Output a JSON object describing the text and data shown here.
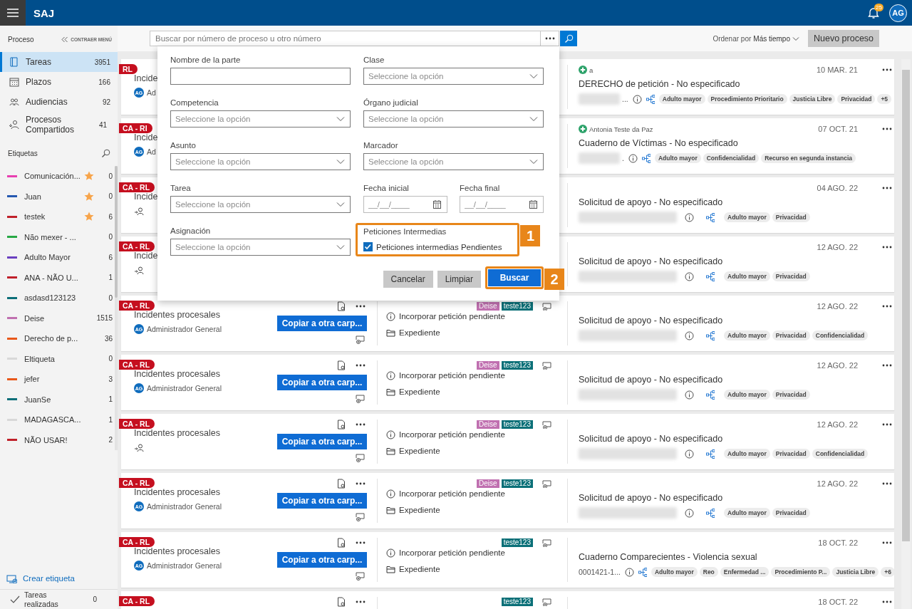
{
  "header": {
    "title": "SAJ",
    "notifications": "25",
    "avatar": "AG"
  },
  "sidebar": {
    "heading": "Proceso",
    "collapse": "CONTRAER MENÚ",
    "nav": [
      {
        "label": "Tareas",
        "count": "3951",
        "kind": "tasks",
        "selected": true
      },
      {
        "label": "Plazos",
        "count": "166",
        "kind": "deadlines",
        "selected": false
      },
      {
        "label": "Audiencias",
        "count": "92",
        "kind": "hearings",
        "selected": false
      },
      {
        "label": "Procesos Compartidos",
        "count": "41",
        "kind": "shared",
        "selected": false
      }
    ],
    "labels_heading": "Etiquetas",
    "labels": [
      {
        "name": "Comunicación...",
        "color": "#e83fb0",
        "starred": true,
        "count": "0"
      },
      {
        "name": "Juan",
        "color": "#2458b0",
        "starred": true,
        "count": "0"
      },
      {
        "name": "testek",
        "color": "#c0202a",
        "starred": true,
        "count": "6"
      },
      {
        "name": "Não mexer - ...",
        "color": "#27a844",
        "starred": false,
        "count": "0"
      },
      {
        "name": "Adulto Mayor",
        "color": "#6a3fc0",
        "starred": false,
        "count": "6"
      },
      {
        "name": "ANA - NÃO U...",
        "color": "#c0202a",
        "starred": false,
        "count": "1"
      },
      {
        "name": "asdasd123123",
        "color": "#0b6e78",
        "starred": false,
        "count": "0"
      },
      {
        "name": "Deise",
        "color": "#c070b0",
        "starred": false,
        "count": "1515"
      },
      {
        "name": "Derecho de p...",
        "color": "#e8581a",
        "starred": false,
        "count": "36"
      },
      {
        "name": "Eltiqueta",
        "color": "#d8d8d8",
        "starred": false,
        "count": "0"
      },
      {
        "name": "jefer",
        "color": "#e8581a",
        "starred": false,
        "count": "3"
      },
      {
        "name": "JuanSe",
        "color": "#0b6e78",
        "starred": false,
        "count": "1"
      },
      {
        "name": "MADAGASCA...",
        "color": "#d8d8d8",
        "starred": false,
        "count": "1"
      },
      {
        "name": "NÃO USAR!",
        "color": "#c0202a",
        "starred": false,
        "count": "2"
      }
    ],
    "create_label": "Crear etiqueta",
    "done": {
      "label": "Tareas realizadas",
      "count": "0"
    }
  },
  "toolbar": {
    "search": {
      "placeholder": "Buscar por número de proceso u otro número"
    },
    "sort_label": "Ordenar por",
    "sort_value": "Más tiempo",
    "new_button": "Nuevo proceso"
  },
  "tasks": [
    {
      "ribbon": "RL",
      "title": "Incide",
      "assigned": true,
      "assignee": {
        "initials": "AG",
        "name": "Ad"
      },
      "party": "a",
      "date": "10 MAR. 21",
      "subject": "DERECHO de petición - No especificado",
      "redacted": true,
      "number": "...",
      "chips": [
        "Adulto mayor",
        "Procedimiento Prioritario",
        "Justicia Libre",
        "Privacidad",
        "+5"
      ]
    },
    {
      "ribbon": "CA - RI",
      "title": "Incide",
      "assigned": true,
      "assignee": {
        "initials": "AG",
        "name": "Ad"
      },
      "party": "Antonia Teste da Paz",
      "date": "07 OCT. 21",
      "subject": "Cuaderno de Víctimas - No especificado",
      "redacted": true,
      "number": ".",
      "chips": [
        "Adulto mayor",
        "Confidencialidad",
        "Recurso en segunda instancia"
      ]
    },
    {
      "ribbon": "CA - RL",
      "title": "Incide",
      "assigned": false,
      "date": "04 AGO. 22",
      "subject": "Solicitud de apoyo - No especificado",
      "redacted": true,
      "chips": [
        "Adulto mayor",
        "Privacidad"
      ]
    },
    {
      "ribbon": "CA - RL",
      "title": "Incide",
      "assigned": false,
      "date": "12 AGO. 22",
      "subject": "Solicitud de apoyo - No especificado",
      "redacted": true,
      "chips": [
        "Adulto mayor",
        "Privacidad"
      ]
    },
    {
      "ribbon": "CA - RL",
      "title": "Incidentes procesales",
      "assigned": true,
      "assignee": {
        "initials": "AG",
        "name": "Administrador General"
      },
      "actions": true,
      "copy_button": "Copiar a otra carp...",
      "tags": [
        {
          "label": "Deise",
          "color": "#c070b0"
        },
        {
          "label": "teste123",
          "color": "#0b7078"
        }
      ],
      "pending": "Incorporar petición pendiente",
      "folder": "Expediente",
      "date": "12 AGO. 22",
      "subject": "Solicitud de apoyo - No especificado",
      "redacted": true,
      "chips": [
        "Adulto mayor",
        "Privacidad",
        "Confidencialidad"
      ]
    },
    {
      "ribbon": "CA - RL",
      "title": "Incidentes procesales",
      "assigned": true,
      "assignee": {
        "initials": "AG",
        "name": "Administrador General"
      },
      "actions": true,
      "copy_button": "Copiar a otra carp...",
      "tags": [
        {
          "label": "Deise",
          "color": "#c070b0"
        },
        {
          "label": "teste123",
          "color": "#0b7078"
        }
      ],
      "pending": "Incorporar petición pendiente",
      "folder": "Expediente",
      "date": "12 AGO. 22",
      "subject": "Solicitud de apoyo - No especificado",
      "redacted": true,
      "chips": [
        "Adulto mayor",
        "Privacidad"
      ]
    },
    {
      "ribbon": "CA - RL",
      "title": "Incidentes procesales",
      "assigned": false,
      "actions": true,
      "copy_button": "Copiar a otra carp...",
      "tags": [
        {
          "label": "Deise",
          "color": "#c070b0"
        },
        {
          "label": "teste123",
          "color": "#0b7078"
        }
      ],
      "pending": "Incorporar petición pendiente",
      "folder": "Expediente",
      "date": "12 AGO. 22",
      "subject": "Solicitud de apoyo - No especificado",
      "redacted": true,
      "chips": [
        "Adulto mayor",
        "Privacidad",
        "Confidencialidad"
      ]
    },
    {
      "ribbon": "CA - RL",
      "title": "Incidentes procesales",
      "assigned": true,
      "assignee": {
        "initials": "AG",
        "name": "Administrador General"
      },
      "actions": true,
      "copy_button": "Copiar a otra carp...",
      "tags": [
        {
          "label": "Deise",
          "color": "#c070b0"
        },
        {
          "label": "teste123",
          "color": "#0b7078"
        }
      ],
      "pending": "Incorporar petición pendiente",
      "folder": "Expediente",
      "date": "12 AGO. 22",
      "subject": "Solicitud de apoyo - No especificado",
      "redacted": true,
      "chips": [
        "Adulto mayor",
        "Privacidad"
      ]
    },
    {
      "ribbon": "CA - RL",
      "title": "Incidentes procesales",
      "assigned": true,
      "assignee": {
        "initials": "AG",
        "name": "Administrador General"
      },
      "actions": true,
      "copy_button": "Copiar a otra carp...",
      "tags": [
        {
          "label": "teste123",
          "color": "#0b7078"
        }
      ],
      "pending": "Incorporar petición pendiente",
      "folder": "Expediente",
      "date": "18 OCT. 22",
      "subject": "Cuaderno Comparecientes - Violencia sexual",
      "number": "0001421-1...",
      "chips": [
        "Adulto mayor",
        "Reo",
        "Enfermedad ...",
        "Procedimiento P...",
        "Justicia Libre",
        "+6"
      ]
    },
    {
      "ribbon": "CA - RL",
      "actions": true,
      "tags": [
        {
          "label": "teste123",
          "color": "#0b7078"
        }
      ],
      "date": "18 OCT. 22"
    }
  ],
  "filter_dialog": {
    "fields": [
      {
        "kind": "text",
        "label": "Nombre de la parte"
      },
      {
        "kind": "select",
        "label": "Clase",
        "placeholder": "Seleccione la opción"
      },
      {
        "kind": "select",
        "label": "Competencia",
        "placeholder": "Seleccione la opción"
      },
      {
        "kind": "select",
        "label": "Órgano judicial",
        "placeholder": "Seleccione la opción"
      },
      {
        "kind": "select",
        "label": "Asunto",
        "placeholder": "Seleccione la opción"
      },
      {
        "kind": "select",
        "label": "Marcador",
        "placeholder": "Seleccione la opción"
      },
      {
        "kind": "select",
        "label": "Tarea",
        "placeholder": "Seleccione la opción"
      },
      {
        "kind": "dates",
        "dates": [
          {
            "label": "Fecha inicial",
            "placeholder": "__/__/____"
          },
          {
            "label": "Fecha final",
            "placeholder": "__/__/____"
          }
        ]
      },
      {
        "kind": "select",
        "label": "Asignación",
        "placeholder": "Seleccione la opción"
      },
      {
        "kind": "checkbox",
        "label": "Peticiones Intermedias",
        "option": "Peticiones intermedias Pendientes",
        "checked": true,
        "callout": "1"
      }
    ],
    "buttons": [
      {
        "label": "Cancelar",
        "kind": "secondary"
      },
      {
        "label": "Limpiar",
        "kind": "secondary"
      },
      {
        "label": "Buscar",
        "kind": "primary",
        "callout": "2"
      }
    ]
  }
}
